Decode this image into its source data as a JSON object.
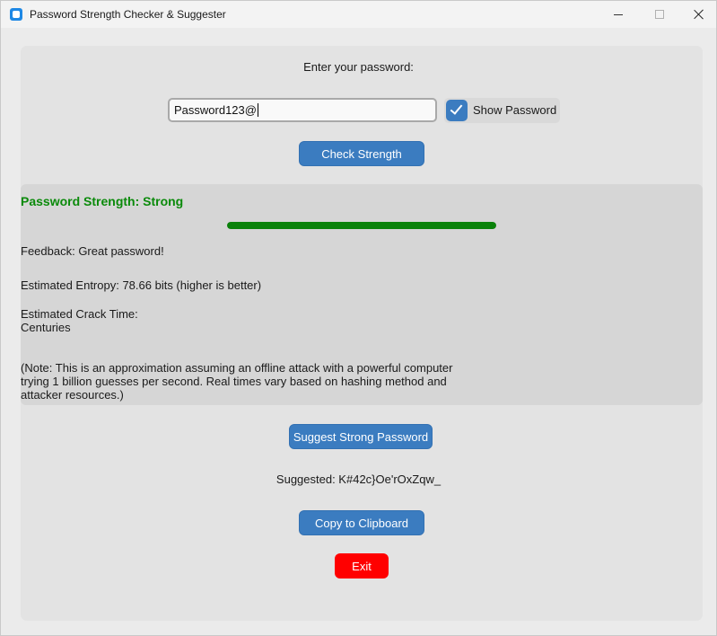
{
  "window": {
    "title": "Password Strength Checker & Suggester"
  },
  "form": {
    "prompt": "Enter your password:",
    "password_value": "Password123@",
    "show_password_label": "Show Password",
    "show_password_checked": true,
    "check_button": "Check Strength"
  },
  "result": {
    "strength_title": "Password Strength: Strong",
    "strength_level": 1.0,
    "strength_color": "#0a820a",
    "feedback": "Feedback: Great password!",
    "entropy": "Estimated Entropy: 78.66 bits (higher is better)",
    "crack_time_label": "Estimated Crack Time:",
    "crack_time_value": "Centuries",
    "note": "(Note: This is an approximation assuming an offline attack with a powerful computer\ntrying 1 billion guesses per second. Real times vary based on hashing method and\nattacker resources.)"
  },
  "suggest": {
    "button": "Suggest Strong Password",
    "suggested_text": "Suggested: K#42c}Oe'rOxZqw_",
    "copy_button": "Copy to Clipboard",
    "exit_button": "Exit"
  },
  "icons": {
    "app": "app-icon",
    "minimize": "minimize-icon",
    "maximize": "maximize-icon",
    "close": "close-icon",
    "check": "checkmark-icon"
  },
  "colors": {
    "accent": "#3b7cc0",
    "exit": "#ff0000",
    "strong": "#0a8a0a"
  }
}
